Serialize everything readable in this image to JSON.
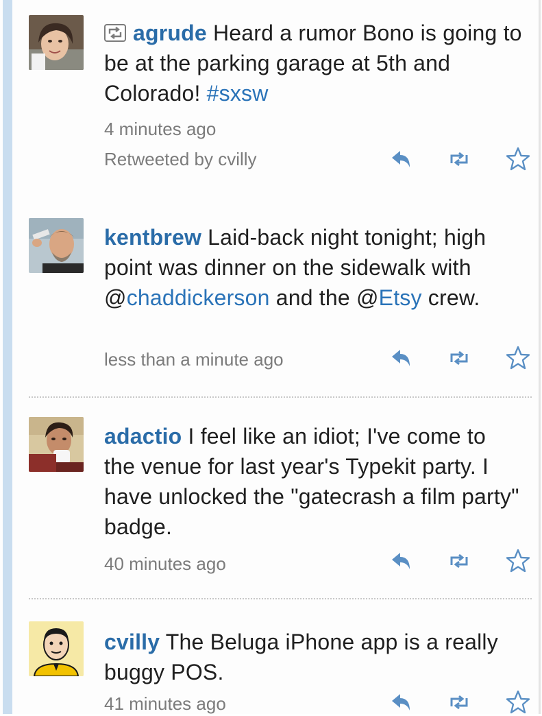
{
  "tweets": [
    {
      "retweet_icon": "retweet-badge-icon",
      "user": "agrude",
      "parts": [
        {
          "type": "text",
          "text": " Heard a rumor Bono is going to be at the parking garage at 5th and Colorado! "
        },
        {
          "type": "link",
          "text": "#sxsw"
        }
      ],
      "time": "4 minutes ago",
      "retweeted_by": "Retweeted by cvilly"
    },
    {
      "user": "kentbrew",
      "parts": [
        {
          "type": "text",
          "text": " Laid-back night tonight; high point was dinner on the sidewalk with @"
        },
        {
          "type": "link",
          "text": "chaddickerson"
        },
        {
          "type": "text",
          "text": " and the @"
        },
        {
          "type": "link",
          "text": "Etsy"
        },
        {
          "type": "text",
          "text": " crew."
        }
      ],
      "time": "less than a minute ago"
    },
    {
      "user": "adactio",
      "parts": [
        {
          "type": "text",
          "text": " I feel like an idiot; I've come to the venue for last year's Typekit party. I have unlocked the \"gatecrash a film party\" badge."
        }
      ],
      "time": "40 minutes ago"
    },
    {
      "user": "cvilly",
      "parts": [
        {
          "type": "text",
          "text": " The Beluga iPhone app is a really buggy POS."
        }
      ],
      "time": "41 minutes ago"
    }
  ],
  "icons": {
    "reply": "reply-arrow-icon",
    "retweet": "retweet-icon",
    "favorite": "star-icon"
  },
  "colors": {
    "username": "#2a6ca8",
    "link": "#2a73b8",
    "meta": "#7b7b7b",
    "action_icon": "#5a8fc4",
    "left_rail": "#c9ddef"
  }
}
